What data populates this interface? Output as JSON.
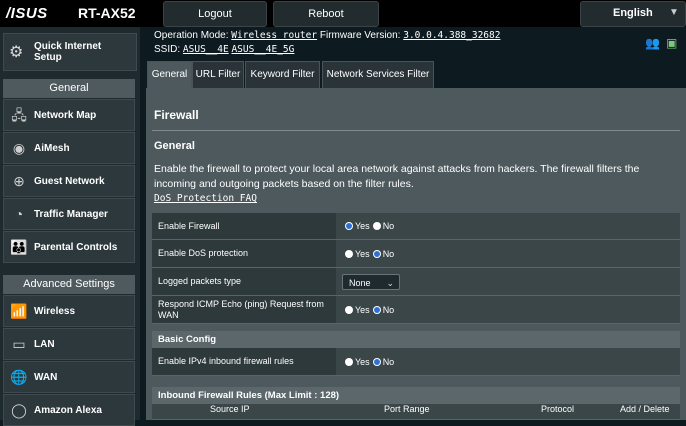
{
  "header": {
    "brand": "/ISUS",
    "model": "RT-AX52",
    "logout": "Logout",
    "reboot": "Reboot",
    "language": "English"
  },
  "info": {
    "opmode_label": "Operation Mode:",
    "opmode_value": "Wireless router",
    "firmware_label": "Firmware Version:",
    "firmware_value": "3.0.0.4.388_32682",
    "ssid_label": "SSID:",
    "ssid_1": "ASUS__4E",
    "ssid_2": "ASUS__4E_5G"
  },
  "sidebar": {
    "quick_setup": "Quick Internet Setup",
    "general_header": "General",
    "general_items": [
      {
        "label": "Network Map",
        "icon": "network-map-icon"
      },
      {
        "label": "AiMesh",
        "icon": "aimesh-icon"
      },
      {
        "label": "Guest Network",
        "icon": "guest-network-icon"
      },
      {
        "label": "Traffic Manager",
        "icon": "traffic-manager-icon"
      },
      {
        "label": "Parental Controls",
        "icon": "parental-controls-icon"
      }
    ],
    "advanced_header": "Advanced Settings",
    "advanced_items": [
      {
        "label": "Wireless",
        "icon": "wireless-icon"
      },
      {
        "label": "LAN",
        "icon": "lan-icon"
      },
      {
        "label": "WAN",
        "icon": "wan-icon"
      },
      {
        "label": "Amazon Alexa",
        "icon": "alexa-icon"
      }
    ]
  },
  "tabs": [
    "General",
    "URL Filter",
    "Keyword Filter",
    "Network Services Filter"
  ],
  "main": {
    "title": "Firewall",
    "section": "General",
    "description": "Enable the firewall to protect your local area network against attacks from hackers. The firewall filters the incoming and outgoing packets based on the filter rules.",
    "faq_link": "DoS Protection FAQ",
    "settings": [
      {
        "label": "Enable Firewall",
        "value": "Yes"
      },
      {
        "label": "Enable DoS protection",
        "value": "No"
      },
      {
        "label": "Logged packets type",
        "value": "None"
      },
      {
        "label": "Respond ICMP Echo (ping) Request from WAN",
        "value": "No"
      }
    ],
    "yes": "Yes",
    "no": "No",
    "basic_config": "Basic Config",
    "ipv4_label": "Enable IPv4 inbound firewall rules",
    "ipv4_value": "No",
    "inbound_header": "Inbound Firewall Rules (Max Limit : 128)",
    "columns": [
      "Source IP",
      "Port Range",
      "Protocol",
      "Add / Delete"
    ]
  }
}
